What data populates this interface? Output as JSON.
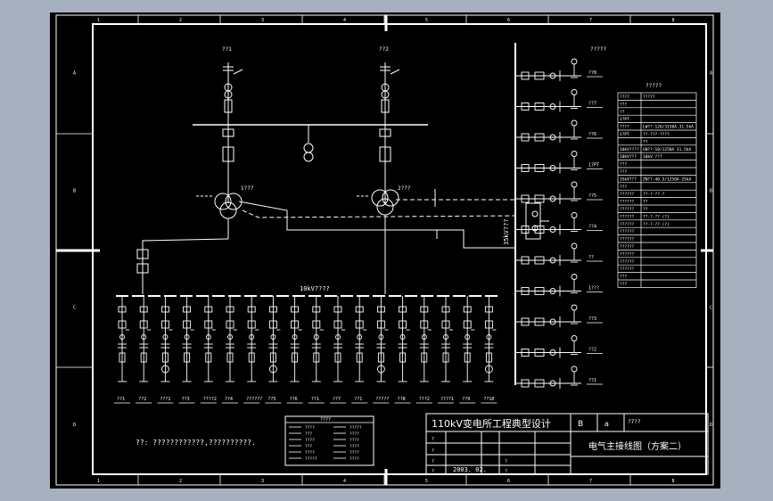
{
  "sheet": {
    "title_block": {
      "main_title": "110kV变电所工程典型设计",
      "drawing_name": "电气主接线图（方案二）",
      "date": "2003. 02.",
      "code": "B",
      "small_a": "a",
      "small_code": "?7??",
      "row_marks": [
        "?",
        "?",
        "?",
        "?",
        "?",
        "?"
      ]
    },
    "edge_numbers": [
      "1",
      "2",
      "3",
      "4",
      "5",
      "6",
      "7",
      "8"
    ],
    "edge_letters": [
      "A",
      "B",
      "C",
      "D"
    ],
    "note": "??: ????????????,??????????.",
    "legend_title": "????",
    "legend_items": [
      "????",
      "???",
      "????",
      "???",
      "????",
      "?????",
      "?????",
      "????",
      "????",
      "????",
      "????",
      "????"
    ],
    "labels": {
      "incoming_1": "??1",
      "incoming_2": "??2",
      "transformer_1": "1???",
      "transformer_2": "2???",
      "bus_10kv": "10kV????",
      "bus_35kv": "35kV???",
      "right_top": "?????"
    },
    "feeders_10kv": [
      "??1",
      "??2",
      "???1",
      "??3",
      "????2",
      "??4",
      "??????",
      "??5",
      "??6",
      "??1",
      "??7",
      "??1",
      "?????",
      "??8",
      "???2",
      "????1",
      "??9",
      "??10"
    ],
    "feeders_35kv": [
      "??8",
      "??7",
      "??6",
      "1?PT",
      "??5",
      "??4",
      "??",
      "1???",
      "??3",
      "??2",
      "??1"
    ],
    "equipment_table": {
      "title": "?????",
      "headers": [
        "????",
        "?????"
      ],
      "rows": [
        [
          "???",
          ""
        ],
        [
          "??",
          ""
        ],
        [
          "1?PT",
          ""
        ],
        [
          "????",
          "LW??-126/3150A 31.5kA"
        ],
        [
          "1?PT",
          "??-???-????"
        ],
        [
          "",
          "??"
        ],
        [
          "10kV????",
          "GN??-10/1250A 31.5kA"
        ],
        [
          "10kV???",
          "10kV ???"
        ],
        [
          "???",
          ""
        ],
        [
          "???",
          ""
        ],
        [
          "35kV???",
          "ZN??-40.5/1250A-25kA"
        ],
        [
          "???",
          ""
        ],
        [
          "??????",
          "??-?-?? ?"
        ],
        [
          "??????",
          "??"
        ],
        [
          "??????",
          "??"
        ],
        [
          "??????",
          "??-?-?? (?)"
        ],
        [
          "??????",
          "??-?-?? (?)"
        ],
        [
          "??????",
          ""
        ],
        [
          "??????",
          ""
        ],
        [
          "??????",
          ""
        ],
        [
          "??????",
          ""
        ],
        [
          "??????",
          ""
        ],
        [
          "??????",
          ""
        ],
        [
          "???",
          ""
        ],
        [
          "???",
          ""
        ]
      ]
    }
  }
}
